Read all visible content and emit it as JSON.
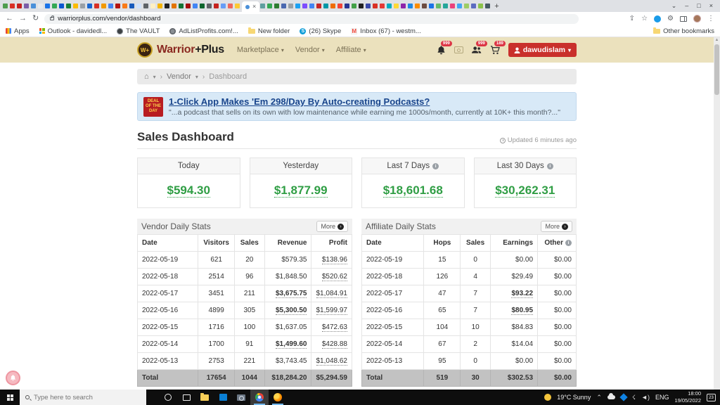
{
  "colors": {
    "header_cream": "#ebe1bd",
    "accent_red": "#c9302c",
    "value_green": "#2f9e44",
    "banner_blue": "#d8e9f7",
    "link_blue": "#19458c",
    "total_gray": "#c2c2c2"
  },
  "browser": {
    "url": "warriorplus.com/vendor/dashboard",
    "active_tab_close": "×",
    "new_tab": "+",
    "window_controls": {
      "menu": "⌄",
      "min": "–",
      "max": "□",
      "close": "×"
    },
    "tab_colors_before": [
      "#4f9d4f",
      "#d93025",
      "#c5221f",
      "#7b5ea7",
      "#4a90d9",
      "#e8eaed",
      "#1a73e8",
      "#34a853",
      "#0b57d0",
      "#188038",
      "#fbbc04",
      "#9aa0a6",
      "#1967d2",
      "#d93025",
      "#f29900",
      "#4285f4",
      "#b31412",
      "#fa7b17",
      "#185abc",
      "#d2e3fc",
      "#5f6368",
      "#feefc3",
      "#f5b400",
      "#202124",
      "#e37400",
      "#137333",
      "#a50e0e",
      "#4285f4",
      "#0d652d",
      "#5f6368",
      "#c5221f",
      "#669df6",
      "#ee675c",
      "#fcc934"
    ],
    "tab_colors_after": [
      "#5f9ea0",
      "#34a853",
      "#2e7d32",
      "#4a68b0",
      "#9aa0a6",
      "#1da1f2",
      "#7c4dff",
      "#4285f4",
      "#c62828",
      "#0097a7",
      "#ef6c00",
      "#f44336",
      "#283593",
      "#43a047",
      "#212121",
      "#3949ab",
      "#d93025",
      "#e53935",
      "#00acc1",
      "#fdd835",
      "#8e24aa",
      "#1e88e5",
      "#fb8c00",
      "#6d4c41",
      "#1a73e8",
      "#66bb6a",
      "#26a69a",
      "#ec407a",
      "#42a5f5",
      "#9ccc65",
      "#5c6bc0",
      "#8bc34a",
      "#455a64"
    ],
    "bookmarks": {
      "items": [
        {
          "label": "Apps",
          "icon": "apps-grid"
        },
        {
          "label": "Outlook - davidedl...",
          "icon": "ms"
        },
        {
          "label": "The VAULT",
          "icon": "globe-dark"
        },
        {
          "label": "AdListProfits.com!...",
          "icon": "globe-gray"
        },
        {
          "label": "New folder",
          "icon": "folder"
        },
        {
          "label": "(26) Skype",
          "icon": "skype"
        },
        {
          "label": "Inbox (67) - westm...",
          "icon": "gmail"
        }
      ],
      "other_label": "Other bookmarks"
    }
  },
  "wp_header": {
    "logo_text": "W+",
    "brand_warrior": "Warrior",
    "brand_plus": "+Plus",
    "nav": [
      "Marketplace",
      "Vendor",
      "Affiliate"
    ],
    "badges": {
      "bell": "999",
      "users": "999",
      "cart": "189"
    },
    "user_button": "dawudislam"
  },
  "breadcrumb": {
    "crumbs": [
      "Vendor",
      "Dashboard"
    ]
  },
  "deal_banner": {
    "badge_lines": [
      "DEAL",
      "OF THE",
      "DAY"
    ],
    "title": "1-Click App Makes 'Em 298/Day By Auto-creating Podcasts?",
    "subtitle": "\"...a podcast that sells on its own with low maintenance while earning me 1000s/month, currently at 10K+ this month?...\""
  },
  "dashboard": {
    "title": "Sales Dashboard",
    "updated": "Updated 6 minutes ago",
    "stat_cards": [
      {
        "label": "Today",
        "value": "$594.30",
        "info": false
      },
      {
        "label": "Yesterday",
        "value": "$1,877.99",
        "info": false
      },
      {
        "label": "Last 7 Days",
        "value": "$18,601.68",
        "info": true
      },
      {
        "label": "Last 30 Days",
        "value": "$30,262.31",
        "info": true
      }
    ],
    "vendor_table": {
      "title": "Vendor Daily Stats",
      "more_label": "More",
      "columns": [
        {
          "label": "Date",
          "info": false
        },
        {
          "label": "Visitors",
          "info": false
        },
        {
          "label": "Sales",
          "info": false
        },
        {
          "label": "Revenue",
          "info": false
        },
        {
          "label": "Profit",
          "info": false
        }
      ],
      "rows": [
        {
          "cells": [
            "2022-05-19",
            "621",
            "20",
            "$579.35",
            "$138.96"
          ],
          "styles": [
            "",
            "",
            "",
            "",
            "u"
          ]
        },
        {
          "cells": [
            "2022-05-18",
            "2514",
            "96",
            "$1,848.50",
            "$520.62"
          ],
          "styles": [
            "",
            "",
            "",
            "",
            "u"
          ]
        },
        {
          "cells": [
            "2022-05-17",
            "3451",
            "211",
            "$3,675.75",
            "$1,084.91"
          ],
          "styles": [
            "",
            "",
            "",
            "bu",
            "u"
          ]
        },
        {
          "cells": [
            "2022-05-16",
            "4899",
            "305",
            "$5,300.50",
            "$1,599.97"
          ],
          "styles": [
            "",
            "",
            "",
            "bu",
            "u"
          ]
        },
        {
          "cells": [
            "2022-05-15",
            "1716",
            "100",
            "$1,637.05",
            "$472.63"
          ],
          "styles": [
            "",
            "",
            "",
            "",
            "u"
          ]
        },
        {
          "cells": [
            "2022-05-14",
            "1700",
            "91",
            "$1,499.60",
            "$428.88"
          ],
          "styles": [
            "",
            "",
            "",
            "bu",
            "u"
          ]
        },
        {
          "cells": [
            "2022-05-13",
            "2753",
            "221",
            "$3,743.45",
            "$1,048.62"
          ],
          "styles": [
            "",
            "",
            "",
            "",
            "u"
          ]
        }
      ],
      "total": {
        "cells": [
          "Total",
          "17654",
          "1044",
          "$18,284.20",
          "$5,294.59"
        ]
      }
    },
    "affiliate_table": {
      "title": "Affiliate Daily Stats",
      "more_label": "More",
      "columns": [
        {
          "label": "Date",
          "info": false
        },
        {
          "label": "Hops",
          "info": false
        },
        {
          "label": "Sales",
          "info": false
        },
        {
          "label": "Earnings",
          "info": false
        },
        {
          "label": "Other",
          "info": true
        }
      ],
      "rows": [
        {
          "cells": [
            "2022-05-19",
            "15",
            "0",
            "$0.00",
            "$0.00"
          ],
          "styles": [
            "",
            "",
            "",
            "",
            ""
          ]
        },
        {
          "cells": [
            "2022-05-18",
            "126",
            "4",
            "$29.49",
            "$0.00"
          ],
          "styles": [
            "",
            "",
            "",
            "",
            ""
          ]
        },
        {
          "cells": [
            "2022-05-17",
            "47",
            "7",
            "$93.22",
            "$0.00"
          ],
          "styles": [
            "",
            "",
            "",
            "bu",
            ""
          ]
        },
        {
          "cells": [
            "2022-05-16",
            "65",
            "7",
            "$80.95",
            "$0.00"
          ],
          "styles": [
            "",
            "",
            "",
            "bu",
            ""
          ]
        },
        {
          "cells": [
            "2022-05-15",
            "104",
            "10",
            "$84.83",
            "$0.00"
          ],
          "styles": [
            "",
            "",
            "",
            "",
            ""
          ]
        },
        {
          "cells": [
            "2022-05-14",
            "67",
            "2",
            "$14.04",
            "$0.00"
          ],
          "styles": [
            "",
            "",
            "",
            "",
            ""
          ]
        },
        {
          "cells": [
            "2022-05-13",
            "95",
            "0",
            "$0.00",
            "$0.00"
          ],
          "styles": [
            "",
            "",
            "",
            "",
            ""
          ]
        }
      ],
      "total": {
        "cells": [
          "Total",
          "519",
          "30",
          "$302.53",
          "$0.00"
        ]
      }
    }
  },
  "taskbar": {
    "search_placeholder": "Type here to search",
    "weather": "19°C Sunny",
    "language": "ENG",
    "time": "18:00",
    "date": "19/05/2022",
    "notification_count": "23"
  }
}
